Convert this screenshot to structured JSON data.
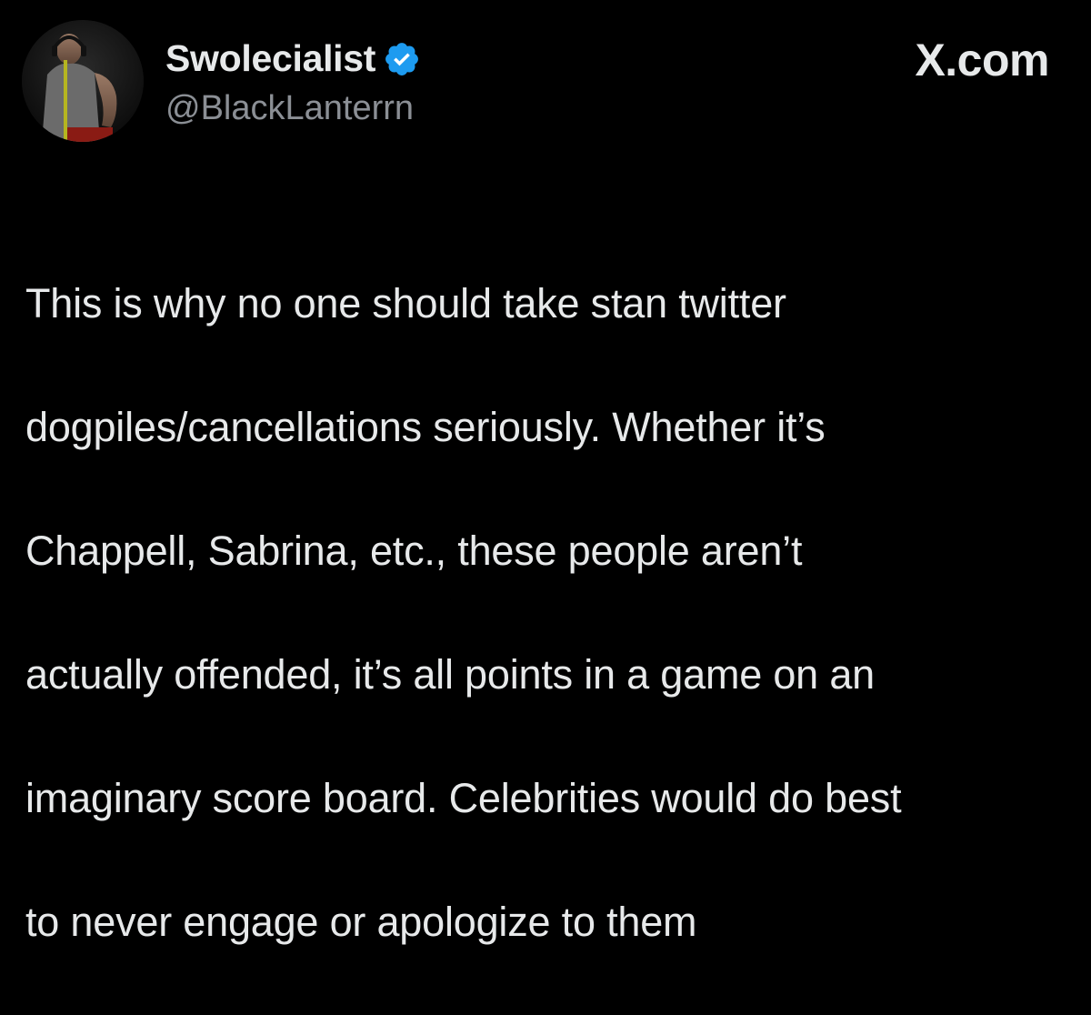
{
  "author": {
    "display_name": "Swolecialist",
    "handle": "@BlackLanterrn",
    "avatar_icon": "profile-photo-avatar",
    "verified_icon": "verified-badge-icon",
    "verified_color": "#1d9bf0"
  },
  "source": {
    "label": "X.com"
  },
  "tweet": {
    "lines": [
      "This is why no one should take stan twitter",
      "dogpiles/cancellations seriously. Whether it’s",
      "Chappell, Sabrina, etc., these people aren’t",
      "actually offended, it’s all points in a game on an",
      "imaginary score board. Celebrities would do best",
      "to never engage or apologize to them"
    ]
  },
  "colors": {
    "background": "#000000",
    "text_primary": "#e7e9ea",
    "text_secondary": "#8b8f95",
    "accent": "#1d9bf0"
  }
}
